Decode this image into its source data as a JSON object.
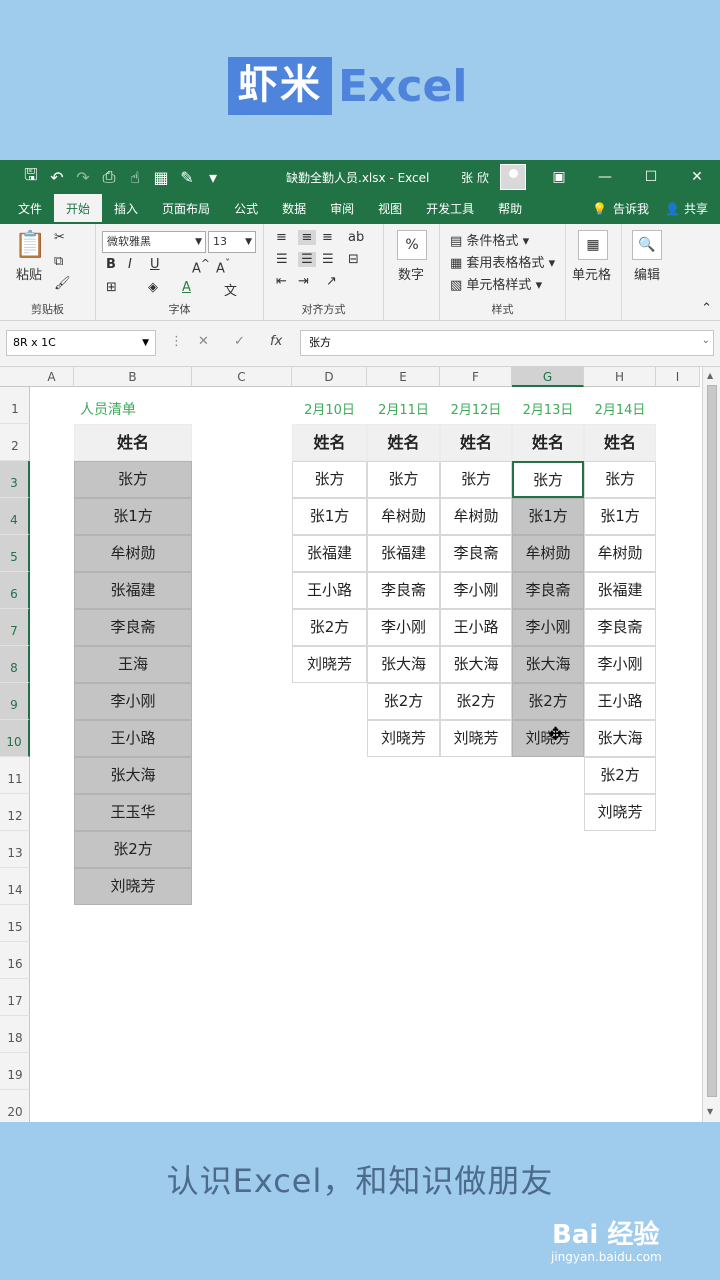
{
  "brand": {
    "box": "虾米",
    "text": "Excel"
  },
  "titlebar": {
    "file": "缺勤全勤人员.xlsx  -  Excel",
    "user": "张 欣",
    "icons": [
      "save-icon",
      "undo-icon",
      "redo-icon",
      "print-preview-icon",
      "touch-mode-icon",
      "form-icon",
      "comment-icon",
      "customize-icon"
    ]
  },
  "tabs": [
    "文件",
    "开始",
    "插入",
    "页面布局",
    "公式",
    "数据",
    "审阅",
    "视图",
    "开发工具",
    "帮助"
  ],
  "tab_active": "开始",
  "tell_me": "告诉我",
  "share": "共享",
  "ribbon": {
    "clipboard": {
      "paste": "粘贴",
      "label": "剪贴板"
    },
    "font": {
      "name": "微软雅黑",
      "size": "13",
      "label": "字体"
    },
    "alignment": {
      "label": "对齐方式"
    },
    "number": {
      "btn": "数字"
    },
    "styles": {
      "cond": "条件格式",
      "table": "套用表格格式",
      "cell": "单元格样式",
      "label": "样式"
    },
    "cells": {
      "btn": "单元格"
    },
    "editing": {
      "btn": "编辑"
    }
  },
  "formula_bar": {
    "namebox": "8R x 1C",
    "value": "张方"
  },
  "columns": [
    "A",
    "B",
    "C",
    "D",
    "E",
    "F",
    "G",
    "H",
    "I"
  ],
  "rows": [
    "1",
    "2",
    "3",
    "4",
    "5",
    "6",
    "7",
    "8",
    "9",
    "10",
    "11",
    "12",
    "13",
    "14",
    "15",
    "16",
    "17",
    "18",
    "19",
    "20"
  ],
  "list": {
    "title": "人员清单",
    "header": "姓名",
    "names": [
      "张方",
      "张1方",
      "牟树勋",
      "张福建",
      "李良斋",
      "王海",
      "李小刚",
      "王小路",
      "张大海",
      "王玉华",
      "张2方",
      "刘晓芳"
    ]
  },
  "days": [
    {
      "date": "2月10日",
      "header": "姓名",
      "names": [
        "张方",
        "张1方",
        "张福建",
        "王小路",
        "张2方",
        "刘晓芳"
      ]
    },
    {
      "date": "2月11日",
      "header": "姓名",
      "names": [
        "张方",
        "牟树勋",
        "张福建",
        "李良斋",
        "李小刚",
        "张大海",
        "张2方",
        "刘晓芳"
      ]
    },
    {
      "date": "2月12日",
      "header": "姓名",
      "names": [
        "张方",
        "牟树勋",
        "李良斋",
        "李小刚",
        "王小路",
        "张大海",
        "张2方",
        "刘晓芳"
      ]
    },
    {
      "date": "2月13日",
      "header": "姓名",
      "names": [
        "张方",
        "张1方",
        "牟树勋",
        "李良斋",
        "李小刚",
        "张大海",
        "张2方",
        "刘晓芳"
      ]
    },
    {
      "date": "2月14日",
      "header": "姓名",
      "names": [
        "张方",
        "张1方",
        "牟树勋",
        "张福建",
        "李良斋",
        "李小刚",
        "王小路",
        "张大海",
        "张2方",
        "刘晓芳"
      ]
    }
  ],
  "caption": "认识Excel，和知识做朋友",
  "watermark": {
    "main": "Bai 经验",
    "sub": "jingyan.baidu.com"
  }
}
